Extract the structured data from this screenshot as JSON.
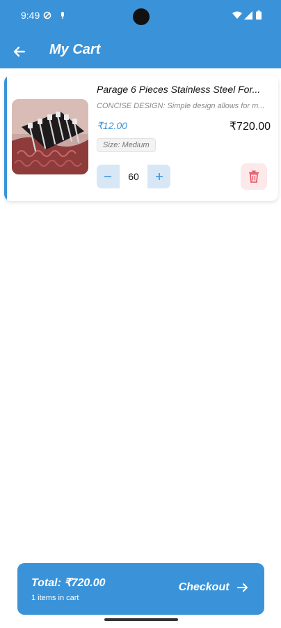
{
  "status_bar": {
    "time": "9:49"
  },
  "header": {
    "title": "My Cart"
  },
  "cart": {
    "items": [
      {
        "name": "Parage 6 Pieces Stainless Steel For...",
        "description": "CONCISE DESIGN: Simple design allows for m...",
        "unit_price": "₹12.00",
        "line_total": "₹720.00",
        "size": "Size: Medium",
        "quantity": "60"
      }
    ]
  },
  "checkout": {
    "total": "Total: ₹720.00",
    "count": "1 items in cart",
    "button_label": "Checkout"
  },
  "colors": {
    "primary": "#3a93d9",
    "danger": "#e84b5a",
    "danger_bg": "#fde8ea"
  }
}
